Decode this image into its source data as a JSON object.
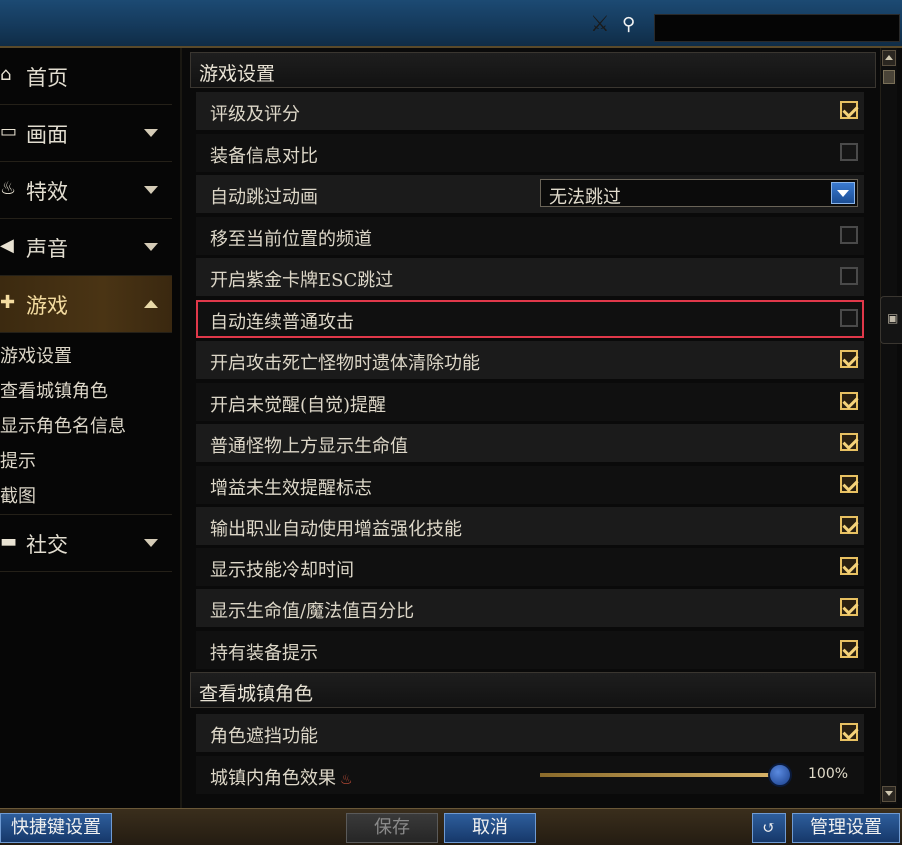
{
  "header": {
    "search_icon": "search-icon",
    "search_value": ""
  },
  "sidebar": {
    "items": [
      {
        "label": "首页",
        "icon": "home-icon",
        "expandable": false
      },
      {
        "label": "画面",
        "icon": "monitor-icon",
        "expandable": true
      },
      {
        "label": "特效",
        "icon": "flame-icon",
        "expandable": true
      },
      {
        "label": "声音",
        "icon": "speaker-icon",
        "expandable": true
      },
      {
        "label": "游戏",
        "icon": "gamepad-icon",
        "expandable": true,
        "active": true
      },
      {
        "label": "社交",
        "icon": "chat-icon",
        "expandable": true
      }
    ],
    "sub_items": [
      "游戏设置",
      "查看城镇角色",
      "显示角色名信息",
      "提示",
      "截图"
    ]
  },
  "sections": [
    {
      "title": "游戏设置",
      "rows": [
        {
          "label": "评级及评分",
          "type": "checkbox",
          "checked": true
        },
        {
          "label": "装备信息对比",
          "type": "checkbox",
          "checked": false
        },
        {
          "label": "自动跳过动画",
          "type": "select",
          "value": "无法跳过"
        },
        {
          "label": "移至当前位置的频道",
          "type": "checkbox",
          "checked": false
        },
        {
          "label": "开启紫金卡牌ESC跳过",
          "type": "checkbox",
          "checked": false
        },
        {
          "label": "自动连续普通攻击",
          "type": "checkbox",
          "checked": false,
          "highlighted": true
        },
        {
          "label": "开启攻击死亡怪物时遗体清除功能",
          "type": "checkbox",
          "checked": true
        },
        {
          "label": "开启未觉醒(自觉)提醒",
          "type": "checkbox",
          "checked": true
        },
        {
          "label": "普通怪物上方显示生命值",
          "type": "checkbox",
          "checked": true
        },
        {
          "label": "增益未生效提醒标志",
          "type": "checkbox",
          "checked": true
        },
        {
          "label": "输出职业自动使用增益强化技能",
          "type": "checkbox",
          "checked": true
        },
        {
          "label": "显示技能冷却时间",
          "type": "checkbox",
          "checked": true
        },
        {
          "label": "显示生命值/魔法值百分比",
          "type": "checkbox",
          "checked": true
        },
        {
          "label": "持有装备提示",
          "type": "checkbox",
          "checked": true
        }
      ]
    },
    {
      "title": "查看城镇角色",
      "rows": [
        {
          "label": "角色遮挡功能",
          "type": "checkbox",
          "checked": true
        },
        {
          "label": "城镇内角色效果",
          "type": "slider",
          "value": 1.0,
          "value_label": "100%"
        }
      ]
    }
  ],
  "bottom": {
    "hotkey_button": "快捷键设置",
    "save_button": "保存",
    "cancel_button": "取消",
    "reset_icon": "reset-icon",
    "manage_button": "管理设置"
  },
  "colors": {
    "accent_gold": "#e8c162",
    "highlight_red": "#e0384a",
    "button_blue": "#2e5e9c"
  }
}
